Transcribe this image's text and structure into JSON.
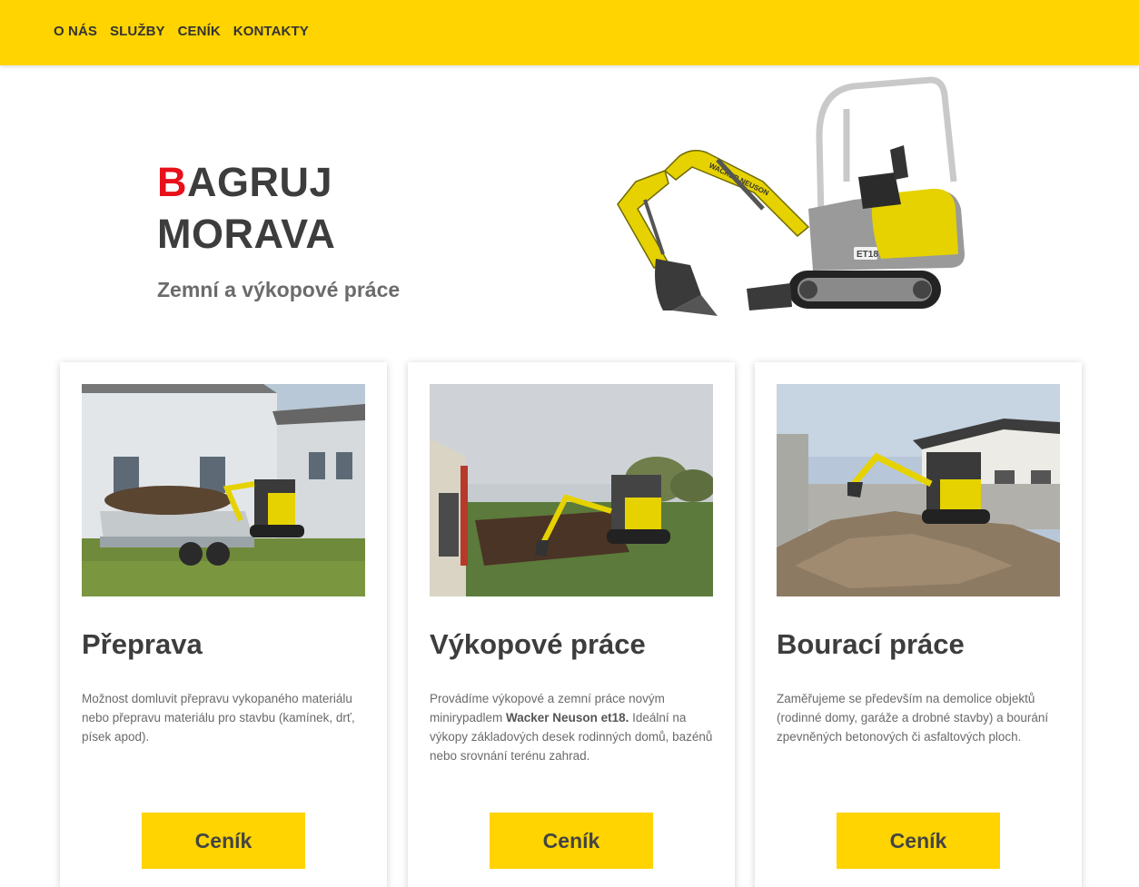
{
  "nav": {
    "items": [
      {
        "label": "O NÁS"
      },
      {
        "label": "SLUŽBY"
      },
      {
        "label": "CENÍK"
      },
      {
        "label": "KONTAKTY"
      }
    ]
  },
  "hero": {
    "title_initial": "B",
    "title_rest": "AGRUJ",
    "title_line2": "MORAVA",
    "subtitle": "Zemní a výkopové práce",
    "machine_badge": "ET18",
    "machine_brand": "WACKER NEUSON"
  },
  "cards": [
    {
      "title": "Přeprava",
      "text": "Možnost domluvit přepravu vykopaného materiálu nebo přepravu materiálu pro stavbu (kamínek, drť, písek apod).",
      "button": "Ceník"
    },
    {
      "title": "Výkopové práce",
      "text_before": "Provádíme výkopové a zemní práce novým minirypadlem ",
      "text_bold": "Wacker Neuson et18.",
      "text_after": " Ideální na výkopy základových desek rodinných domů, bazénů nebo srovnání terénu zahrad.",
      "button": "Ceník"
    },
    {
      "title": "Bourací práce",
      "text": "Zaměřujeme se především na demolice objektů (rodinné domy, garáže a drobné stavby) a bourání zpevněných betonových či asfaltových ploch.",
      "button": "Ceník"
    }
  ],
  "colors": {
    "brand_yellow": "#ffd400",
    "accent_red": "#e8101a",
    "heading": "#3d3d3d"
  }
}
